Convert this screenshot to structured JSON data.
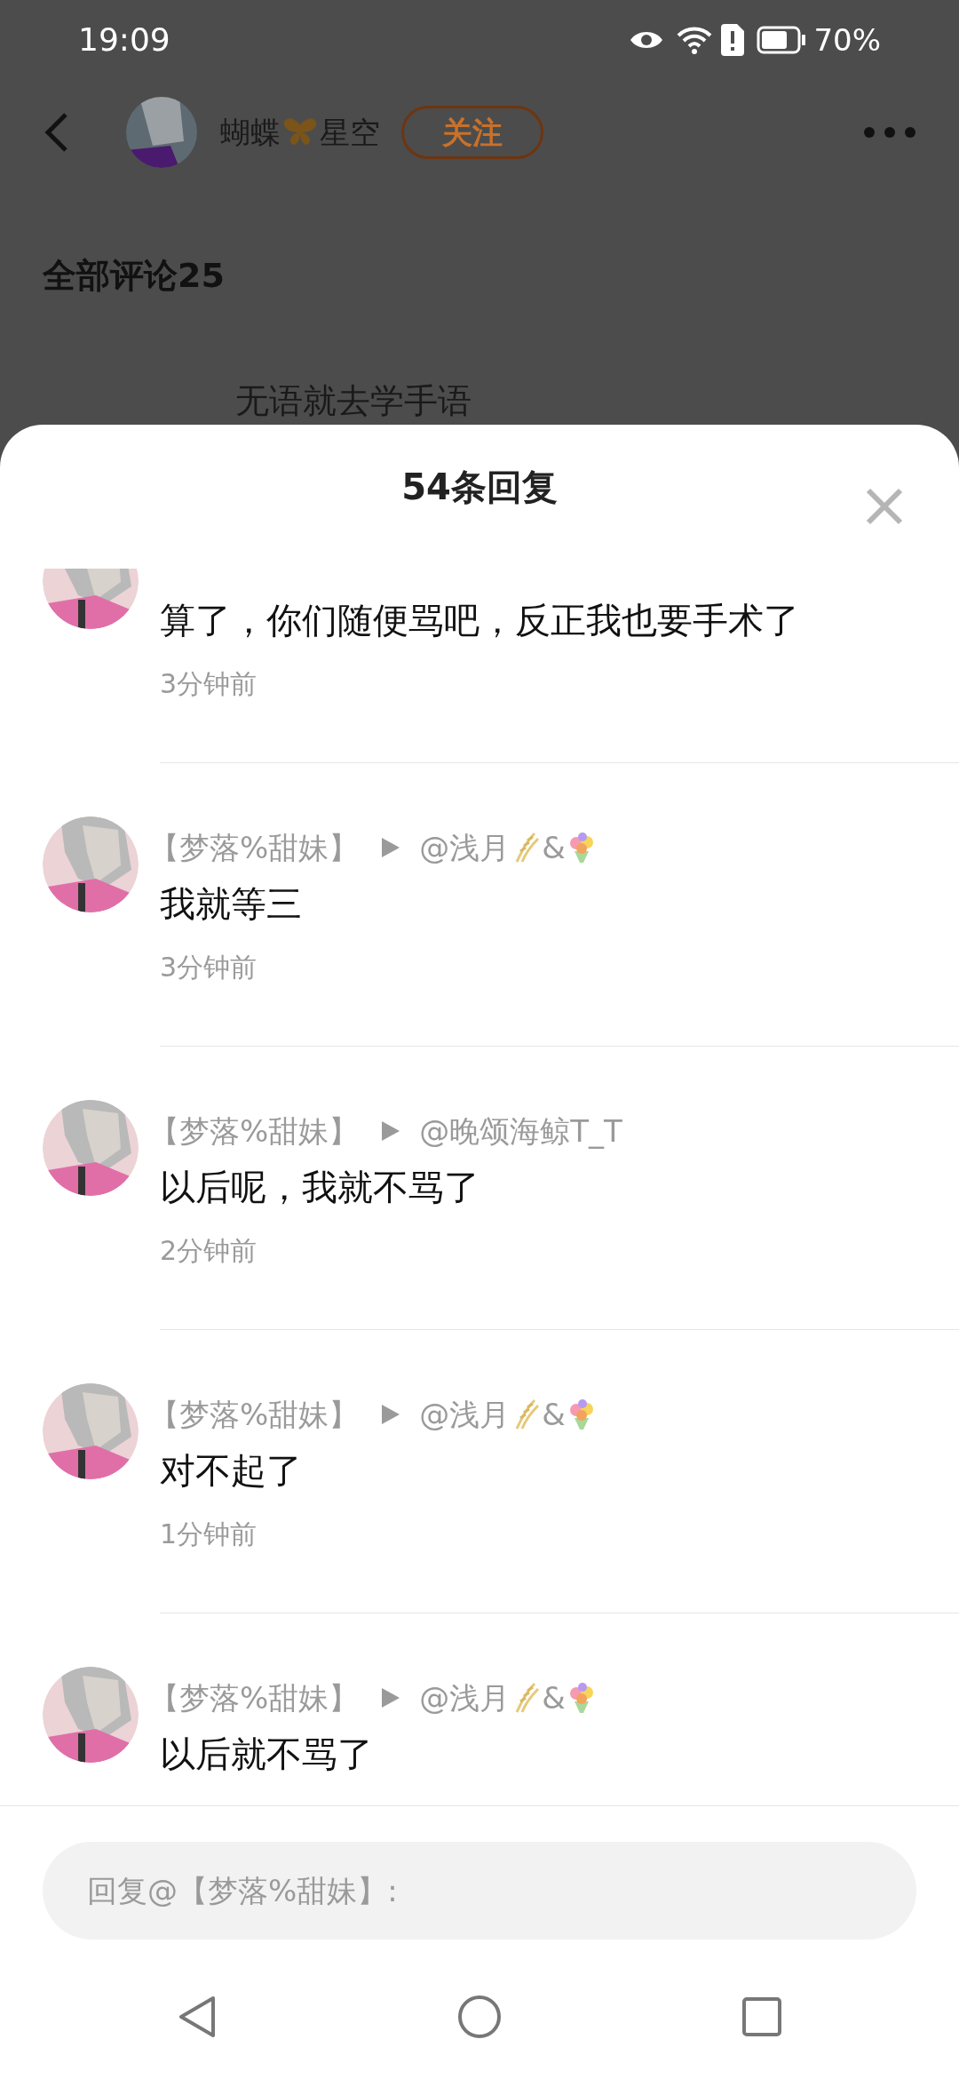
{
  "status_bar": {
    "time": "19:09",
    "battery": "70%"
  },
  "header": {
    "author": "蝴蝶",
    "author_suffix": "星空",
    "follow": "关注"
  },
  "comments_heading": "全部评论25",
  "background_comment": "无语就去学手语",
  "sheet": {
    "title": "54条回复"
  },
  "replies": [
    {
      "text": "算了，你们随便骂吧，反正我也要手术了",
      "time": "3分钟前"
    },
    {
      "author": "【梦落%甜妹】",
      "reply_to": [
        {
          "kind": "text",
          "text": "@浅月"
        },
        {
          "kind": "wheat"
        },
        {
          "kind": "text",
          "text": "&"
        },
        {
          "kind": "bouquet"
        }
      ],
      "text": "我就等三",
      "time": "3分钟前"
    },
    {
      "author": "【梦落%甜妹】",
      "reply_to": [
        {
          "kind": "text",
          "text": "@晚颂海鲸T_T"
        }
      ],
      "text": "以后呢，我就不骂了",
      "time": "2分钟前"
    },
    {
      "author": "【梦落%甜妹】",
      "reply_to": [
        {
          "kind": "text",
          "text": "@浅月"
        },
        {
          "kind": "wheat"
        },
        {
          "kind": "text",
          "text": "&"
        },
        {
          "kind": "bouquet"
        }
      ],
      "text": "对不起了",
      "time": "1分钟前"
    },
    {
      "author": "【梦落%甜妹】",
      "reply_to": [
        {
          "kind": "text",
          "text": "@浅月"
        },
        {
          "kind": "wheat"
        },
        {
          "kind": "text",
          "text": "&"
        },
        {
          "kind": "bouquet"
        }
      ],
      "text": "以后就不骂了"
    }
  ],
  "reply_input": {
    "placeholder": "回复@【梦落%甜妹】:"
  }
}
